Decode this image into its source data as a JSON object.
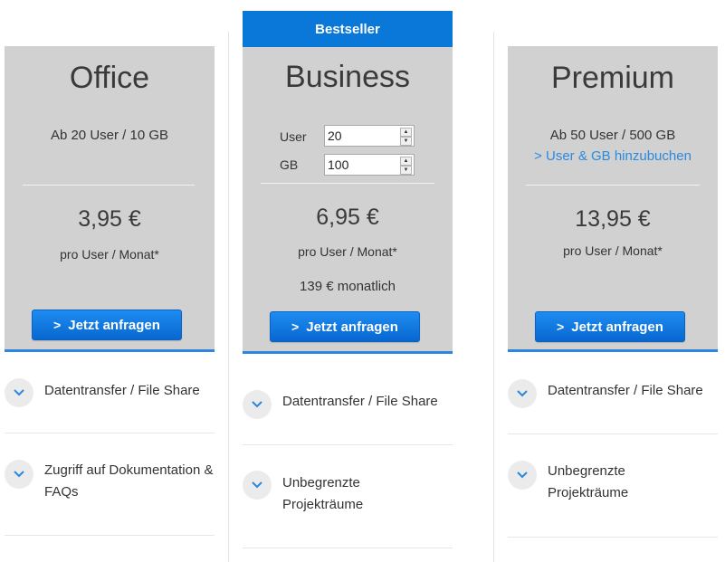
{
  "plans": [
    {
      "name": "Office",
      "description": "Ab 20 User / 10 GB",
      "price": "3,95 €",
      "price_unit": "pro User / Monat*",
      "cta_label": "Jetzt anfragen",
      "features": [
        {
          "text": "Datentransfer / File Share",
          "icon": "chevron-down-icon"
        },
        {
          "text": "Zugriff auf Dokumentation & FAQs",
          "icon": "chevron-down-icon"
        }
      ]
    },
    {
      "badge": "Bestseller",
      "name": "Business",
      "user_label": "User",
      "user_value": "20",
      "gb_label": "GB",
      "gb_value": "100",
      "price": "6,95 €",
      "price_unit": "pro User / Monat*",
      "monthly_total": "139 € monatlich",
      "cta_label": "Jetzt anfragen",
      "features": [
        {
          "text": "Datentransfer / File Share",
          "icon": "chevron-down-icon"
        },
        {
          "text": "Unbegrenzte Projekträume",
          "icon": "chevron-down-icon"
        }
      ]
    },
    {
      "name": "Premium",
      "description": "Ab 50 User / 500 GB",
      "addon_link": "> User & GB hinzubuchen",
      "price": "13,95 €",
      "price_unit": "pro User / Monat*",
      "cta_label": "Jetzt anfragen",
      "features": [
        {
          "text": "Datentransfer / File Share",
          "icon": "chevron-down-icon"
        },
        {
          "text": "Unbegrenzte Projekträume",
          "icon": "chevron-down-icon"
        }
      ]
    }
  ],
  "colors": {
    "card_background": "#d1d1d1",
    "accent_blue": "#0a78d9",
    "link_blue": "#2a8ae0",
    "button_gradient_top": "#1e8cf2",
    "button_gradient_bottom": "#0767cf"
  }
}
